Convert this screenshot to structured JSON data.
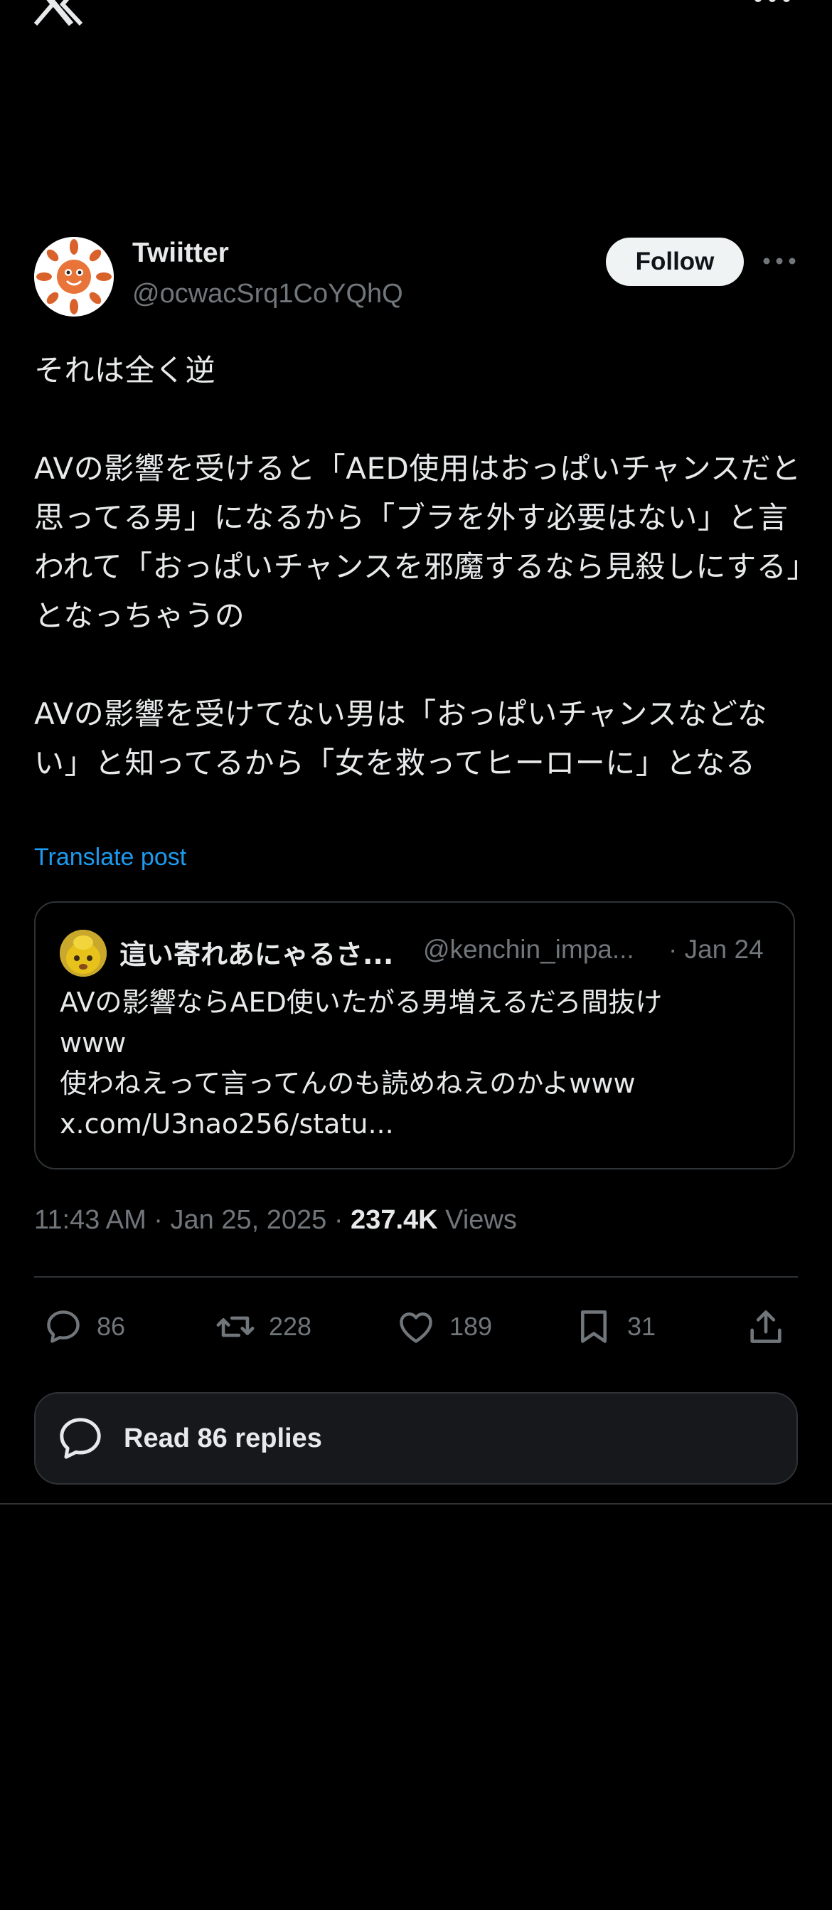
{
  "nav": {
    "logo_icon": "x-logo-icon",
    "more_icon": "more-horizontal-icon"
  },
  "author": {
    "display_name": "Twiitter",
    "handle": "@ocwacSrq1CoYQhQ",
    "follow_label": "Follow"
  },
  "tweet": {
    "text": "それは全く逆\n\nAVの影響を受けると「AED使用はおっぱいチャンスだと思ってる男」になるから「ブラを外す必要はない」と言われて「おっぱいチャンスを邪魔するなら見殺しにする」となっちゃうの\n\nAVの影響を受けてない男は「おっぱいチャンスなどない」と知ってるから「女を救ってヒーローに」となる",
    "translate_label": "Translate post",
    "time": "11:43 AM",
    "date": "Jan 25, 2025",
    "views_count": "237.4K",
    "views_label": "Views"
  },
  "quote": {
    "name": "這い寄れあにゃるさ...",
    "handle": "@kenchin_impa...",
    "date": "· Jan 24",
    "text": "AVの影響ならAED使いたがる男増えるだろ間抜け\nwww\n使わねえって言ってんのも読めねえのかよwww\nx.com/U3nao256/statu..."
  },
  "actions": {
    "replies": "86",
    "reposts": "228",
    "likes": "189",
    "bookmarks": "31"
  },
  "read_replies_label": "Read 86 replies",
  "colors": {
    "background": "#000000",
    "text": "#e7e9ea",
    "secondary": "#71767b",
    "accent": "#1d9bf0",
    "border": "#2f3336"
  }
}
